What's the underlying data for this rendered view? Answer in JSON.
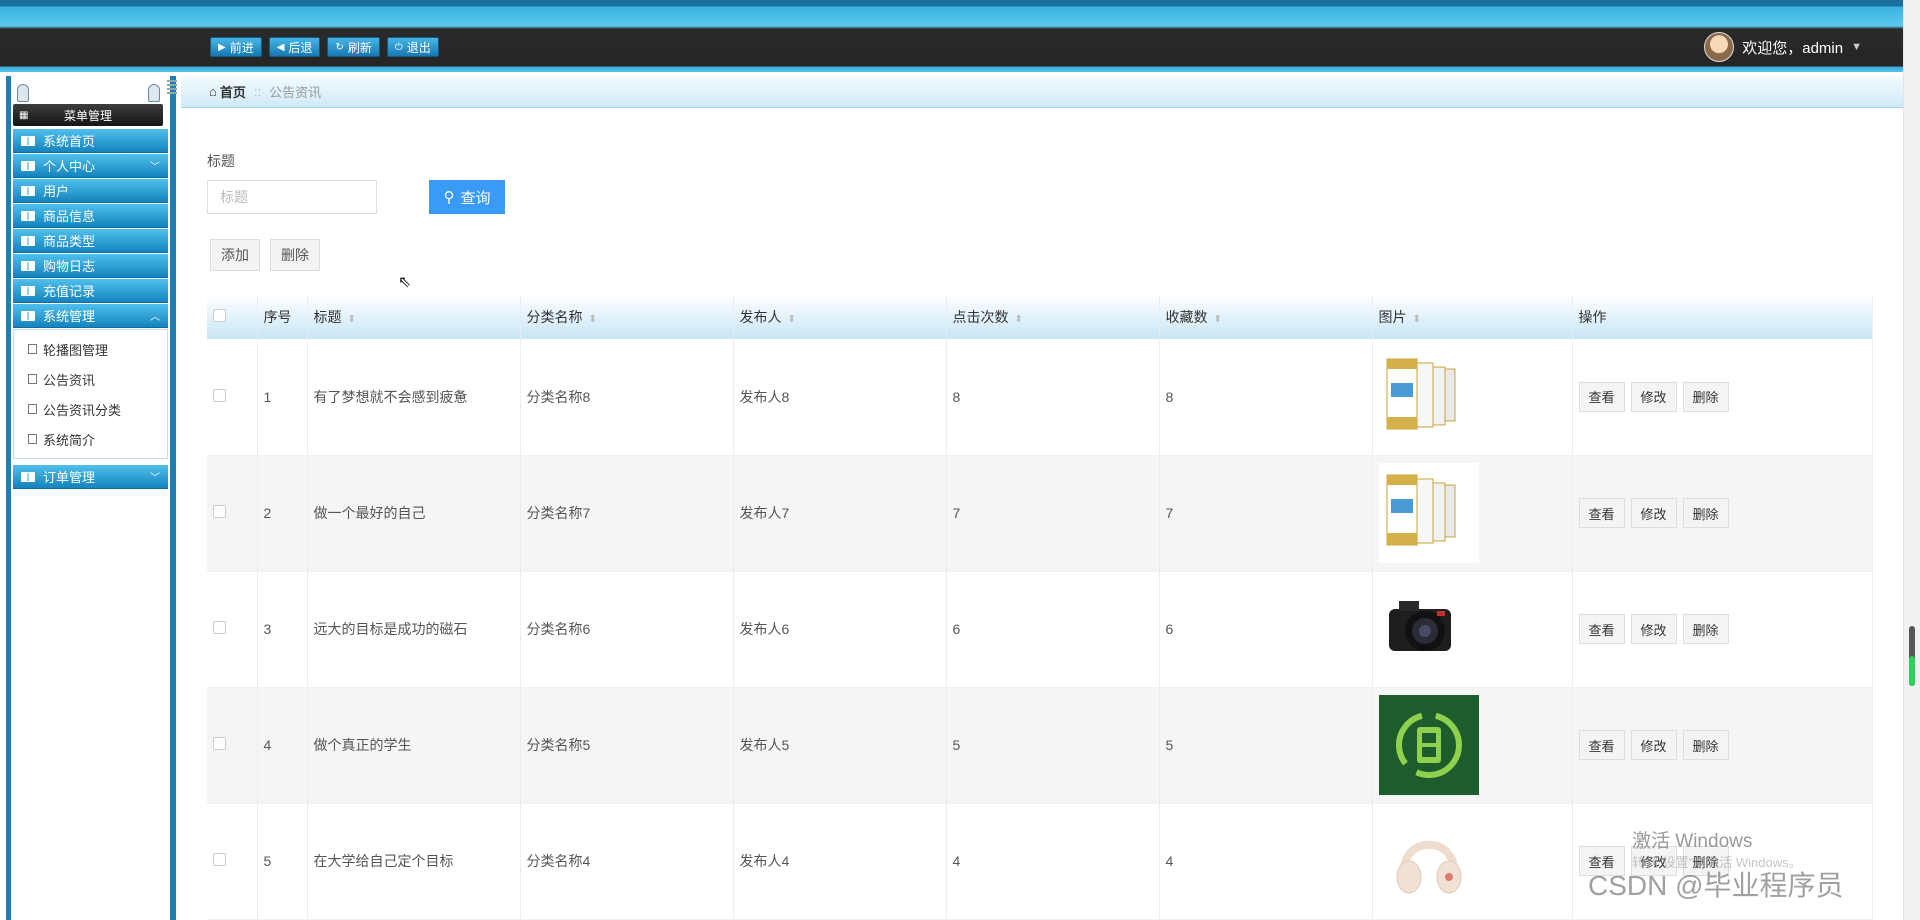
{
  "topbar": {
    "nav_buttons": [
      {
        "label": "前进",
        "icon": "play-right-icon",
        "glyph": "▶"
      },
      {
        "label": "后退",
        "icon": "play-left-icon",
        "glyph": "◀"
      },
      {
        "label": "刷新",
        "icon": "refresh-icon",
        "glyph": "↻"
      },
      {
        "label": "退出",
        "icon": "power-icon",
        "glyph": "⏻"
      }
    ],
    "welcome_text": "欢迎您，admin"
  },
  "sidebar": {
    "title": "菜单管理",
    "items": [
      {
        "label": "系统首页",
        "chevron": ""
      },
      {
        "label": "个人中心",
        "chevron": "v"
      },
      {
        "label": "用户",
        "chevron": ""
      },
      {
        "label": "商品信息",
        "chevron": ""
      },
      {
        "label": "商品类型",
        "chevron": ""
      },
      {
        "label": "购物日志",
        "chevron": ""
      },
      {
        "label": "充值记录",
        "chevron": ""
      },
      {
        "label": "系统管理",
        "chevron": "^"
      }
    ],
    "subitems": [
      "轮播图管理",
      "公告资讯",
      "公告资讯分类",
      "系统简介"
    ],
    "last_item": {
      "label": "订单管理",
      "chevron": "v"
    }
  },
  "breadcrumb": {
    "home": "首页",
    "separator": "::",
    "current": "公告资讯"
  },
  "search": {
    "label": "标题",
    "placeholder": "标题",
    "button_label": "查询"
  },
  "actions": {
    "add_label": "添加",
    "delete_label": "删除"
  },
  "table": {
    "columns": [
      "序号",
      "标题",
      "分类名称",
      "发布人",
      "点击次数",
      "收藏数",
      "图片",
      "操作"
    ],
    "op_labels": {
      "view": "查看",
      "edit": "修改",
      "delete": "删除"
    },
    "rows": [
      {
        "no": "1",
        "title": "有了梦想就不会感到疲惫",
        "category": "分类名称8",
        "publisher": "发布人8",
        "clicks": "8",
        "favorites": "8",
        "image": "milk-powder-cans"
      },
      {
        "no": "2",
        "title": "做一个最好的自己",
        "category": "分类名称7",
        "publisher": "发布人7",
        "clicks": "7",
        "favorites": "7",
        "image": "milk-powder-cans"
      },
      {
        "no": "3",
        "title": "远大的目标是成功的磁石",
        "category": "分类名称6",
        "publisher": "发布人6",
        "clicks": "6",
        "favorites": "6",
        "image": "camera"
      },
      {
        "no": "4",
        "title": "做个真正的学生",
        "category": "分类名称5",
        "publisher": "发布人5",
        "clicks": "5",
        "favorites": "5",
        "image": "fresh-logo"
      },
      {
        "no": "5",
        "title": "在大学给自己定个目标",
        "category": "分类名称4",
        "publisher": "发布人4",
        "clicks": "4",
        "favorites": "4",
        "image": "headphones"
      }
    ]
  },
  "overlay": {
    "windows_title": "激活 Windows",
    "windows_sub": "转到\"设置\"以激活 Windows。",
    "csdn": "CSDN @毕业程序员"
  },
  "colors": {
    "accent": "#3a9bf6",
    "menu_blue": "#1583bd",
    "topbar_dark": "#252525"
  }
}
